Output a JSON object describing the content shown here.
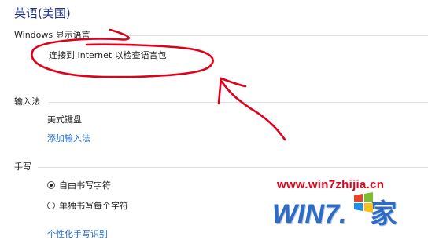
{
  "header": {
    "title": "英语(美国)"
  },
  "display_language": {
    "section_title": "Windows 显示语言",
    "status_text": "连接到 Internet 以检查语言包"
  },
  "input_method": {
    "section_title": "输入法",
    "keyboard": "美式键盘",
    "add_link": "添加输入法"
  },
  "handwriting": {
    "section_title": "手写",
    "options": [
      {
        "label": "自由书写字符",
        "selected": true
      },
      {
        "label": "单独书写每个字符",
        "selected": false
      }
    ],
    "personalize_link": "个性化手写识别"
  },
  "watermark": {
    "url": "www.win7zhijia.cn",
    "logo_text": "WIN7.",
    "logo_char": "家"
  },
  "colors": {
    "title": "#1e3287",
    "link": "#1f6fd1",
    "annotation": "#e0001a",
    "divider": "#d9dfe6"
  }
}
